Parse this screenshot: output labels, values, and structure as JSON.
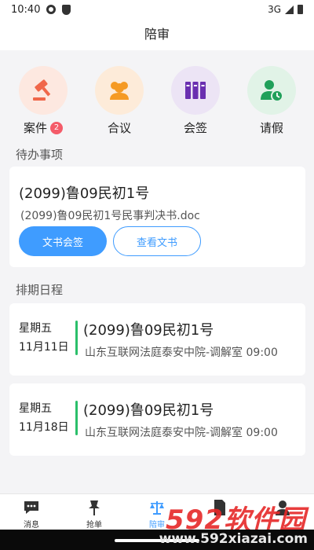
{
  "status_bar": {
    "time": "10:40",
    "network": "3G"
  },
  "header": {
    "title": "陪审"
  },
  "quick_actions": [
    {
      "label": "案件",
      "icon": "gavel-icon",
      "badge": "2",
      "bg": "#fde8e0",
      "fg": "#f0674a"
    },
    {
      "label": "合议",
      "icon": "people-icon",
      "badge": "",
      "bg": "#fdebd9",
      "fg": "#f59a24"
    },
    {
      "label": "会签",
      "icon": "binders-icon",
      "badge": "",
      "bg": "#ece4f5",
      "fg": "#6a2fb0"
    },
    {
      "label": "请假",
      "icon": "user-clock-icon",
      "badge": "",
      "bg": "#e1f3e7",
      "fg": "#20a05a"
    }
  ],
  "todo": {
    "section_title": "待办事项",
    "case_no": "(2099)鲁09民初1号",
    "document": "(2099)鲁09民初1号民事判决书.doc",
    "primary_button": "文书会签",
    "secondary_button": "查看文书"
  },
  "schedule": {
    "section_title": "排期日程",
    "items": [
      {
        "weekday": "星期五",
        "date": "11月11日",
        "case_no": "(2099)鲁09民初1号",
        "place": "山东互联网法庭泰安中院-调解室 09:00"
      },
      {
        "weekday": "星期五",
        "date": "11月18日",
        "case_no": "(2099)鲁09民初1号",
        "place": "山东互联网法庭泰安中院-调解室 09:00"
      }
    ]
  },
  "tabbar": {
    "tabs": [
      {
        "label": "消息",
        "icon": "chat-icon"
      },
      {
        "label": "抢单",
        "icon": "pin-icon"
      },
      {
        "label": "陪审",
        "icon": "scales-icon",
        "active": true
      },
      {
        "label": "",
        "icon": "document-icon"
      },
      {
        "label": "",
        "icon": "user-icon"
      }
    ]
  },
  "watermark": {
    "brand": "592软件园",
    "url": "www.592xiazai.com"
  },
  "colors": {
    "accent": "#3f9cff",
    "green": "#2bbf6a",
    "badge": "#f45b69"
  }
}
